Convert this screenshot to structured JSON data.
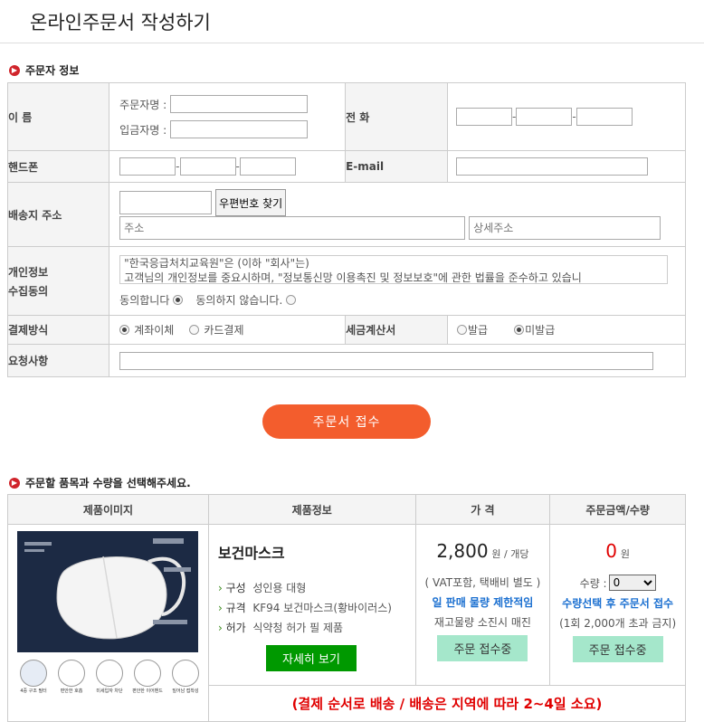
{
  "page": {
    "title": "온라인주문서 작성하기"
  },
  "orderer": {
    "section_title": "주문자 정보",
    "name_label": "이 름",
    "orderer_name_label": "주문자명 :",
    "depositor_name_label": "입금자명 :",
    "phone_label": "전 화",
    "mobile_label": "핸드폰",
    "email_label": "E-mail",
    "address_label": "배송지 주소",
    "zip_button": "우편번호 찾기",
    "address_placeholder": "주소",
    "address_detail_placeholder": "상세주소",
    "privacy_label_1": "개인정보",
    "privacy_label_2": "수집동의",
    "privacy_text": "\"한국응급처치교육원\"은 (이하 \"회사\"는)\n고객님의 개인정보를 중요시하며, \"정보통신망 이용촉진 및 정보보호\"에 관한 법률을 준수하고 있습니",
    "agree_label": "동의합니다",
    "disagree_label": "동의하지 않습니다.",
    "privacy_selected": "agree",
    "payment_label": "결제방식",
    "payment_options": [
      "계좌이체",
      "카드결제"
    ],
    "payment_selected": "계좌이체",
    "tax_label": "세금계산서",
    "tax_options": [
      "발급",
      "미발급"
    ],
    "tax_selected": "미발급",
    "request_label": "요청사항",
    "submit_button": "주문서 접수"
  },
  "products": {
    "section_title": "주문할 품목과 수량을 선택해주세요.",
    "headers": [
      "제품이미지",
      "제품정보",
      "가 격",
      "주문금액/수량"
    ],
    "item": {
      "name": "보건마스크",
      "specs": [
        {
          "key": "구성",
          "value": "성인용 대형"
        },
        {
          "key": "규격",
          "value": "KF94 보건마스크(황바이러스)"
        },
        {
          "key": "허가",
          "value": "식약청 허가 필 제품"
        }
      ],
      "detail_button": "자세히 보기",
      "price": "2,800",
      "price_unit": "원 / 개당",
      "price_note": "( VAT포함, 택배비 별도 )",
      "limit_note": "일 판매 물량 제한적임",
      "stock_note": "재고물량 소진시 매진",
      "status_button": "주문 접수중",
      "amount": "0",
      "amount_unit": "원",
      "qty_label": "수량 :",
      "qty_value": "0",
      "qty_note": "수량선택 후 주문서 접수",
      "qty_limit": "(1회 2,000개 초과 금지)",
      "icon_labels": [
        "4중 구조 필터",
        "편안한 호흡",
        "미세입자 차단",
        "편안한 이어밴드",
        "밀어남 접착성"
      ]
    },
    "shipping_notice": "(결제 순서로 배송 / 배송은 지역에 따라 2~4일 소요)"
  },
  "colors": {
    "submit": "#f35d2d",
    "detail_button": "#009900",
    "status_button": "#a5e7cb",
    "amount": "#e00000",
    "notice": "#e00000",
    "blue_note": "#1a6fd0"
  }
}
